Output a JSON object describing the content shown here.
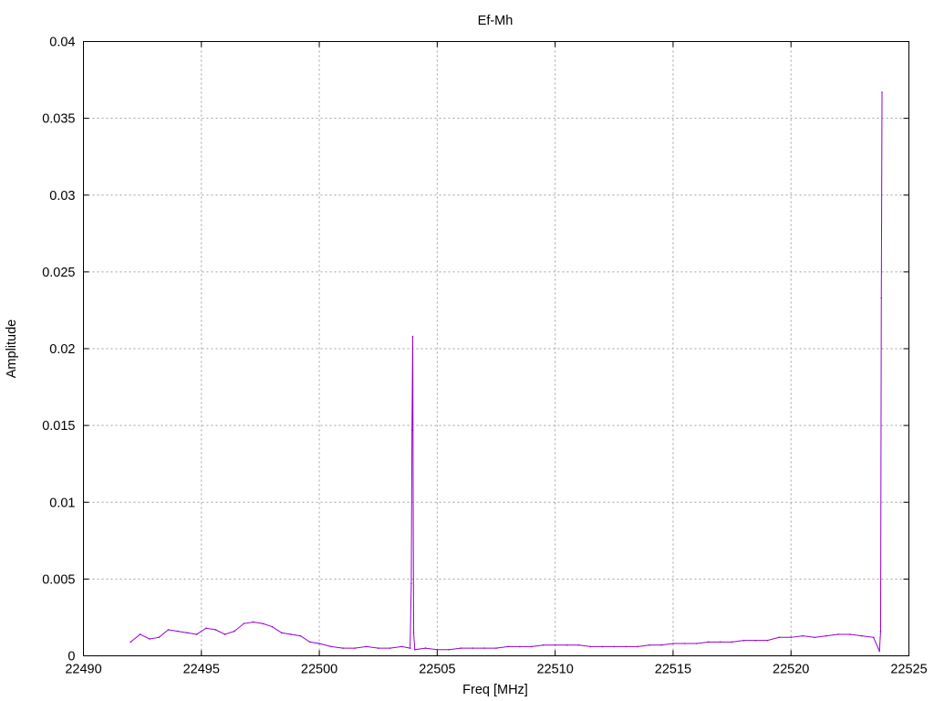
{
  "chart_data": {
    "type": "line",
    "title": "Ef-Mh",
    "xlabel": "Freq [MHz]",
    "ylabel": "Amplitude",
    "xlim": [
      22490,
      22525
    ],
    "ylim": [
      0,
      0.04
    ],
    "x_ticks": [
      22490,
      22495,
      22500,
      22505,
      22510,
      22515,
      22520,
      22525
    ],
    "y_ticks": [
      0,
      0.005,
      0.01,
      0.015,
      0.02,
      0.025,
      0.03,
      0.035,
      0.04
    ],
    "x_tick_labels": [
      "22490",
      "22495",
      "22500",
      "22505",
      "22510",
      "22515",
      "22520",
      "22525"
    ],
    "y_tick_labels": [
      "0",
      "0.005",
      "0.01",
      "0.015",
      "0.02",
      "0.025",
      "0.03",
      "0.035",
      "0.04"
    ],
    "grid": true,
    "line_color": "#9400d3",
    "series": [
      {
        "values": [
          [
            22492.0,
            0.0009
          ],
          [
            22492.4,
            0.0014
          ],
          [
            22492.8,
            0.0011
          ],
          [
            22493.2,
            0.0012
          ],
          [
            22493.6,
            0.0017
          ],
          [
            22494.0,
            0.0016
          ],
          [
            22494.4,
            0.0015
          ],
          [
            22494.8,
            0.0014
          ],
          [
            22495.2,
            0.0018
          ],
          [
            22495.6,
            0.0017
          ],
          [
            22496.0,
            0.0014
          ],
          [
            22496.4,
            0.0016
          ],
          [
            22496.8,
            0.0021
          ],
          [
            22497.2,
            0.0022
          ],
          [
            22497.6,
            0.0021
          ],
          [
            22498.0,
            0.0019
          ],
          [
            22498.4,
            0.0015
          ],
          [
            22498.8,
            0.0014
          ],
          [
            22499.2,
            0.0013
          ],
          [
            22499.6,
            0.0009
          ],
          [
            22500.0,
            0.0008
          ],
          [
            22500.5,
            0.0006
          ],
          [
            22501.0,
            0.0005
          ],
          [
            22501.5,
            0.0005
          ],
          [
            22502.0,
            0.0006
          ],
          [
            22502.5,
            0.0005
          ],
          [
            22503.0,
            0.0005
          ],
          [
            22503.5,
            0.0006
          ],
          [
            22503.85,
            0.0005
          ],
          [
            22503.9,
            0.0047
          ],
          [
            22503.93,
            0.0147
          ],
          [
            22503.96,
            0.0208
          ],
          [
            22504.0,
            0.0015
          ],
          [
            22504.05,
            0.0004
          ],
          [
            22504.5,
            0.0005
          ],
          [
            22505.0,
            0.0004
          ],
          [
            22505.5,
            0.0004
          ],
          [
            22506.0,
            0.0005
          ],
          [
            22506.5,
            0.0005
          ],
          [
            22507.0,
            0.0005
          ],
          [
            22507.5,
            0.0005
          ],
          [
            22508.0,
            0.0006
          ],
          [
            22508.5,
            0.0006
          ],
          [
            22509.0,
            0.0006
          ],
          [
            22509.5,
            0.0007
          ],
          [
            22510.0,
            0.0007
          ],
          [
            22510.5,
            0.0007
          ],
          [
            22511.0,
            0.0007
          ],
          [
            22511.5,
            0.0006
          ],
          [
            22512.0,
            0.0006
          ],
          [
            22512.5,
            0.0006
          ],
          [
            22513.0,
            0.0006
          ],
          [
            22513.5,
            0.0006
          ],
          [
            22514.0,
            0.0007
          ],
          [
            22514.5,
            0.0007
          ],
          [
            22515.0,
            0.0008
          ],
          [
            22515.5,
            0.0008
          ],
          [
            22516.0,
            0.0008
          ],
          [
            22516.5,
            0.0009
          ],
          [
            22517.0,
            0.0009
          ],
          [
            22517.5,
            0.0009
          ],
          [
            22518.0,
            0.001
          ],
          [
            22518.5,
            0.001
          ],
          [
            22519.0,
            0.001
          ],
          [
            22519.5,
            0.0012
          ],
          [
            22520.0,
            0.0012
          ],
          [
            22520.5,
            0.0013
          ],
          [
            22521.0,
            0.0012
          ],
          [
            22521.5,
            0.0013
          ],
          [
            22522.0,
            0.0014
          ],
          [
            22522.5,
            0.0014
          ],
          [
            22523.0,
            0.0013
          ],
          [
            22523.5,
            0.0012
          ],
          [
            22523.75,
            0.0003
          ],
          [
            22523.8,
            0.0016
          ],
          [
            22523.83,
            0.0233
          ],
          [
            22523.86,
            0.0367
          ]
        ]
      }
    ]
  }
}
